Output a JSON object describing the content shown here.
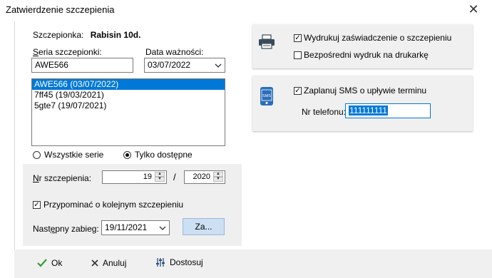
{
  "window": {
    "title": "Zatwierdzenie szczepienia",
    "close_glyph": "✕"
  },
  "patient": {
    "label": "Szczepionka:",
    "name": "Rabisin 10d."
  },
  "series": {
    "label_first": "S",
    "label_rest": "eria szczepionki:",
    "value": "AWE566"
  },
  "expiry": {
    "label": "Data ważności:",
    "value": "03/07/2022"
  },
  "series_list": [
    {
      "text": "AWE566 (03/07/2022)",
      "selected": true
    },
    {
      "text": "7ff45 (19/03/2021)",
      "selected": false
    },
    {
      "text": "5gte7 (19/07/2021)",
      "selected": false
    }
  ],
  "filter": {
    "all_label": "Wszystkie serie",
    "available_label": "Tylko dostępne",
    "selected": "available"
  },
  "vaccination_number": {
    "label_first": "N",
    "label_rest": "r szczepienia:",
    "number": "19",
    "separator": "/",
    "year": "2020"
  },
  "reminder": {
    "label": "Przypominać o kolejnym szczepieniu",
    "checked": true
  },
  "next_visit": {
    "label_first": "Nast",
    "label_under": "ę",
    "label_rest": "pny zabieg:",
    "date": "19/11/2021",
    "button_label": "Za..."
  },
  "print_card": {
    "icon": "printer-icon",
    "print_certificate_label": "Wydrukuj zaświadczenie o szczepieniu",
    "print_certificate_checked": true,
    "direct_print_label": "Bezpośredni wydruk na drukarkę",
    "direct_print_checked": false
  },
  "sms_card": {
    "icon": "sms-phone-icon",
    "icon_text": "SMS",
    "schedule_label": "Zaplanuj SMS o upływie terminu",
    "schedule_checked": true,
    "phone_label": "Nr telefonu:",
    "phone_value": "111111111"
  },
  "footer": {
    "ok_label": "Ok",
    "cancel_label": "Anuluj",
    "customize_label": "Dostosuj"
  },
  "colors": {
    "selection": "#0078d7",
    "ok_check": "#2e9e3e",
    "accent_button": "#ccdff3",
    "sms_icon": "#2a6ebb"
  }
}
